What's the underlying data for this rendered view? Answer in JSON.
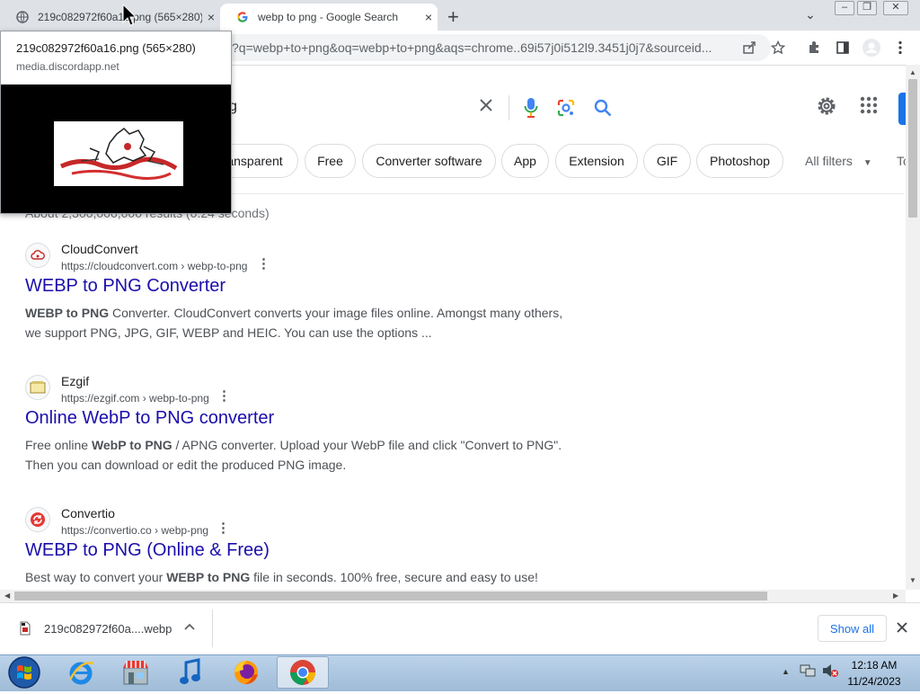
{
  "browser": {
    "tabs": [
      {
        "title": "219c082972f60a16.png (565×280)",
        "close": "×"
      },
      {
        "title": "webp to png - Google Search",
        "close": "×"
      }
    ],
    "new_tab": "+",
    "tab_search": "⌄",
    "window_controls": [
      "–",
      "❐",
      "✕"
    ],
    "address": "?q=webp+to+png&oq=webp+to+png&aqs=chrome..69i57j0i512l9.3451j0j7&sourceid..."
  },
  "hover_card": {
    "title": "219c082972f60a16.png (565×280)",
    "domain": "media.discordapp.net"
  },
  "search": {
    "query_visible": "g",
    "filters": [
      "ansparent",
      "Free",
      "Converter software",
      "App",
      "Extension",
      "GIF",
      "Photoshop"
    ],
    "all_filters": "All filters",
    "tools": "To",
    "stats": "About 2,300,000,000 results (0.24 seconds)"
  },
  "results": [
    {
      "site": "CloudConvert",
      "url": "https://cloudconvert.com › webp-to-png",
      "title": "WEBP to PNG Converter",
      "snippet_bold": "WEBP to PNG",
      "snippet_rest": " Converter. CloudConvert converts your image files online. Amongst many others, we support PNG, JPG, GIF, WEBP and HEIC. You can use the options ..."
    },
    {
      "site": "Ezgif",
      "url": "https://ezgif.com › webp-to-png",
      "title": "Online WebP to PNG converter",
      "snippet_pre": "Free online ",
      "snippet_bold": "WebP to PNG",
      "snippet_rest": " / APNG converter. Upload your WebP file and click \"Convert to PNG\". Then you can download or edit the produced PNG image."
    },
    {
      "site": "Convertio",
      "url": "https://convertio.co › webp-png",
      "title": "WEBP to PNG (Online & Free)",
      "snippet_pre": "Best way to convert your ",
      "snippet_bold": "WEBP to PNG",
      "snippet_rest": " file in seconds. 100% free, secure and easy to use!"
    }
  ],
  "downloads": {
    "filename": "219c082972f60a....webp",
    "show_all": "Show all"
  },
  "taskbar": {
    "time": "12:18 AM",
    "date": "11/24/2023"
  },
  "colors": {
    "link": "#1a0dab",
    "accent": "#1a73e8",
    "tab_strip": "#dee1e6"
  }
}
